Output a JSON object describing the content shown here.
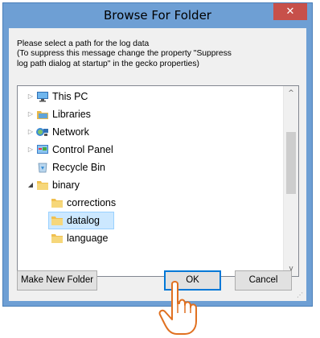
{
  "dialog": {
    "title": "Browse For Folder",
    "close_glyph": "✕",
    "message_lines": [
      "Please select a path for the log data",
      "(To suppress this message change the property \"Suppress",
      "log path dialog at startup\" in the gecko properties)"
    ]
  },
  "tree": {
    "items": [
      {
        "label": "This PC",
        "icon": "computer-icon",
        "expander": "▷"
      },
      {
        "label": "Libraries",
        "icon": "libraries-icon",
        "expander": "▷"
      },
      {
        "label": "Network",
        "icon": "network-icon",
        "expander": "▷"
      },
      {
        "label": "Control Panel",
        "icon": "control-panel-icon",
        "expander": "▷"
      },
      {
        "label": "Recycle Bin",
        "icon": "recycle-bin-icon",
        "expander": ""
      },
      {
        "label": "binary",
        "icon": "folder-icon",
        "expander": "◢"
      },
      {
        "label": "corrections",
        "icon": "folder-icon",
        "expander": ""
      },
      {
        "label": "datalog",
        "icon": "folder-icon",
        "expander": "",
        "selected": true
      },
      {
        "label": "language",
        "icon": "folder-icon",
        "expander": ""
      }
    ],
    "scroll_up": "^",
    "scroll_down": "v"
  },
  "buttons": {
    "make_new_folder": "Make New Folder",
    "ok": "OK",
    "cancel": "Cancel"
  },
  "colors": {
    "accent": "#0078d7",
    "title_bar": "#6e9fd4",
    "close": "#c7504a",
    "selection": "#cce8ff"
  }
}
